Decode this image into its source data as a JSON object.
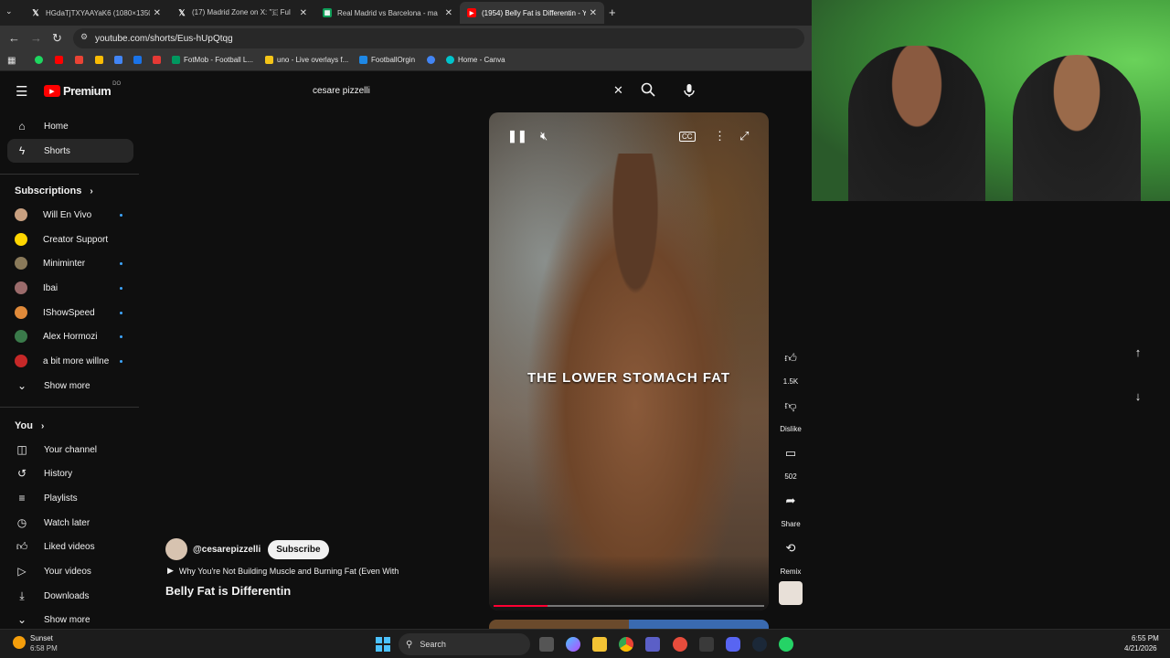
{
  "browser": {
    "tabs": [
      {
        "title": "HGdaTjTXYAAYaK6 (1080×1350",
        "icon": "x-logo-icon",
        "active": false
      },
      {
        "title": "(17) Madrid Zone on X: \"🇪 Ful",
        "icon": "x-logo-icon",
        "active": false
      },
      {
        "title": "Real Madrid vs Barcelona - ma",
        "icon": "sheets-icon",
        "active": false
      },
      {
        "title": "(1954) Belly Fat is Differentin - Y",
        "icon": "youtube-icon",
        "active": true
      }
    ],
    "url": "youtube.com/shorts/Eus-hUpQtqg",
    "bookmarks": [
      {
        "label": "",
        "color": "#1ed760"
      },
      {
        "label": "",
        "color": "#ff0000"
      },
      {
        "label": "",
        "color": "#ea4335"
      },
      {
        "label": "",
        "color": "#fbbc04"
      },
      {
        "label": "",
        "color": "#4285f4"
      },
      {
        "label": "",
        "color": "#e53935"
      },
      {
        "label": "FotMob - Football L...",
        "color": "#00985f"
      },
      {
        "label": "uno - Live overlays f...",
        "color": "#f5c518"
      },
      {
        "label": "FootballOrgin",
        "color": "#1e88e5"
      },
      {
        "label": "",
        "color": "#4285f4"
      },
      {
        "label": "Home - Canva",
        "color": "#00c4cc"
      }
    ]
  },
  "youtube": {
    "logo": "Premium",
    "logo_sup": "DO",
    "search_value": "cesare pizzelli",
    "nav": [
      {
        "label": "Home",
        "icon": "home-icon"
      },
      {
        "label": "Shorts",
        "icon": "shorts-icon"
      }
    ],
    "subscriptions_heading": "Subscriptions",
    "subscriptions": [
      {
        "label": "Will En Vivo",
        "color": "#c8a080",
        "dot": true
      },
      {
        "label": "Creator Support",
        "color": "#ffd600",
        "dot": false
      },
      {
        "label": "Miniminter",
        "color": "#8a7a5a",
        "dot": true
      },
      {
        "label": "Ibai",
        "color": "#9b6b6b",
        "dot": true
      },
      {
        "label": "IShowSpeed",
        "color": "#e08a3a",
        "dot": true
      },
      {
        "label": "Alex Hormozi",
        "color": "#3a7a4a",
        "dot": true
      },
      {
        "label": "a bit more willne",
        "color": "#c62828",
        "dot": true
      }
    ],
    "show_more": "Show more",
    "you_heading": "You",
    "you_items": [
      {
        "label": "Your channel",
        "icon": "channel-icon"
      },
      {
        "label": "History",
        "icon": "history-icon"
      },
      {
        "label": "Playlists",
        "icon": "playlists-icon"
      },
      {
        "label": "Watch later",
        "icon": "watch-later-icon"
      },
      {
        "label": "Liked videos",
        "icon": "like-icon"
      },
      {
        "label": "Your videos",
        "icon": "your-videos-icon"
      },
      {
        "label": "Downloads",
        "icon": "download-icon"
      }
    ],
    "show_more_2": "Show more",
    "short": {
      "caption": "THE LOWER STOMACH FAT",
      "channel": "@cesarepizzelli",
      "subscribe": "Subscribe",
      "related": "Why You're Not Building Muscle and Burning Fat (Even With",
      "title": "Belly Fat is Differentin",
      "progress": 0.2
    },
    "actions": [
      {
        "label": "1.5K",
        "icon": "thumbs-up-icon"
      },
      {
        "label": "Dislike",
        "icon": "thumbs-down-icon"
      },
      {
        "label": "502",
        "icon": "comment-icon"
      },
      {
        "label": "Share",
        "icon": "share-icon"
      },
      {
        "label": "Remix",
        "icon": "remix-icon"
      }
    ]
  },
  "taskbar": {
    "weather_label": "Sunset",
    "weather_time": "6:58 PM",
    "search": "Search",
    "clock_time": "6:55 PM",
    "clock_date": "4/21/2026"
  }
}
